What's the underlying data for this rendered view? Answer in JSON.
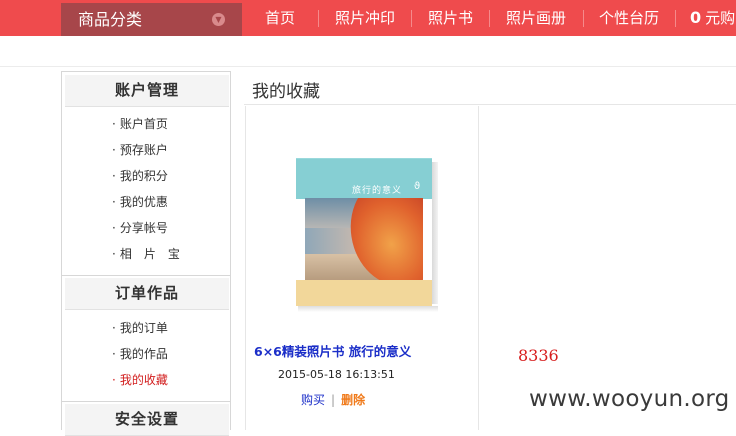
{
  "nav": {
    "category_label": "商品分类",
    "items": [
      "首页",
      "照片冲印",
      "照片书",
      "照片画册",
      "个性台历"
    ],
    "cart_count": "0",
    "cart_label": "元购"
  },
  "sidebar": {
    "sections": [
      {
        "title": "账户管理",
        "items": [
          "账户首页",
          "预存账户",
          "我的积分",
          "我的优惠",
          "分享帐号",
          "相　片　宝"
        ]
      },
      {
        "title": "订单作品",
        "items": [
          "我的订单",
          "我的作品",
          "我的收藏"
        ]
      },
      {
        "title": "安全设置",
        "items": []
      }
    ],
    "bullet": "·"
  },
  "main": {
    "title": "我的收藏",
    "product": {
      "cover_text": "旅行的意义",
      "name": "6×6精装照片书 旅行的意义",
      "date": "2015-05-18 16:13:51",
      "buy_label": "购买",
      "separator": "|",
      "delete_label": "删除"
    }
  },
  "annotation": {
    "number": "8336"
  },
  "watermark": "www.wooyun.org",
  "colors": {
    "nav_bg": "#ef4b4d",
    "category_bg": "#a7464a",
    "active_link": "#d21e1e",
    "product_link": "#1b2ec8",
    "delete_link": "#f07a1a"
  }
}
